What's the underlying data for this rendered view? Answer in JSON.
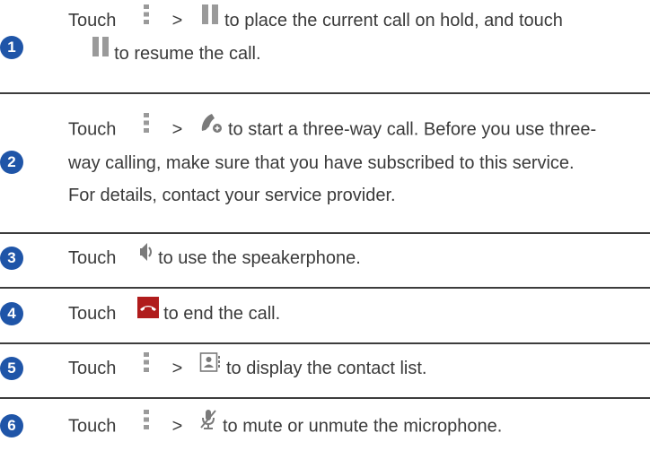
{
  "colors": {
    "badge": "#1f55a8",
    "text": "#3a3a3a",
    "divider": "#3c3c3c",
    "icon_gray": "#9a9a9a",
    "end_call_red": "#b01c1c"
  },
  "steps": [
    {
      "number": "1",
      "touch": "Touch",
      "sep": ">",
      "text_a": "to place the current call on hold, and touch",
      "text_b": "to resume the call.",
      "icons": [
        "menu-icon",
        "hold-icon",
        "hold-icon"
      ]
    },
    {
      "number": "2",
      "touch": "Touch",
      "sep": ">",
      "text_a": "to start a three-way call. Before you use three-",
      "text_b": "way calling, make sure that you have subscribed to this service.",
      "text_c": "For details, contact your service provider.",
      "icons": [
        "menu-icon",
        "add-call-icon"
      ]
    },
    {
      "number": "3",
      "touch": "Touch",
      "text_a": "to use the speakerphone.",
      "icons": [
        "speaker-icon"
      ]
    },
    {
      "number": "4",
      "touch": "Touch",
      "text_a": "to end the call.",
      "icons": [
        "end-call-icon"
      ]
    },
    {
      "number": "5",
      "touch": "Touch",
      "sep": ">",
      "text_a": "to display the contact list.",
      "icons": [
        "menu-icon",
        "contacts-icon"
      ]
    },
    {
      "number": "6",
      "touch": "Touch",
      "sep": ">",
      "text_a": "to mute or unmute the microphone.",
      "icons": [
        "menu-icon",
        "mute-mic-icon"
      ]
    }
  ]
}
